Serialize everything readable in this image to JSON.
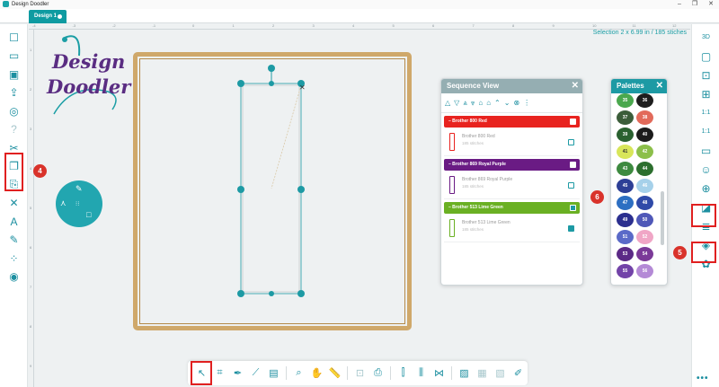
{
  "window": {
    "title": "Design Doodler",
    "controls": [
      "–",
      "❐",
      "✕"
    ]
  },
  "tabs": [
    {
      "label": "Design 1"
    }
  ],
  "selection_info": "Selection   2 x 6.99 in / 185 stiches",
  "ruler": {
    "top": [
      "-4",
      "-3",
      "-2",
      "-1",
      "0",
      "1",
      "2",
      "3",
      "4",
      "5",
      "6",
      "7",
      "8",
      "9",
      "10",
      "11",
      "12"
    ],
    "left": [
      "1",
      "2",
      "3",
      "4",
      "5",
      "6",
      "7",
      "8",
      "9"
    ]
  },
  "logo": {
    "line1": "Design",
    "line2": "Doodler"
  },
  "left_toolbar": [
    {
      "name": "new-design-icon",
      "glyph": "☐"
    },
    {
      "name": "open-folder-icon",
      "glyph": "▭"
    },
    {
      "name": "import-image-icon",
      "glyph": "▣"
    },
    {
      "name": "export-icon",
      "glyph": "⇪"
    },
    {
      "name": "stitch-settings-icon",
      "glyph": "◎"
    },
    {
      "name": "help-icon",
      "glyph": "?"
    },
    {
      "name": "cut-icon",
      "glyph": "✂"
    },
    {
      "name": "copy-icon",
      "glyph": "❐"
    },
    {
      "name": "paste-icon",
      "glyph": "⎘"
    },
    {
      "name": "delete-icon",
      "glyph": "✕"
    },
    {
      "name": "text-icon",
      "glyph": "A"
    },
    {
      "name": "draw-path-icon",
      "glyph": "✎"
    },
    {
      "name": "node-edit-icon",
      "glyph": "⁘"
    },
    {
      "name": "brush-tool-icon",
      "glyph": "◉"
    }
  ],
  "right_toolbar": [
    {
      "name": "3d-view-icon",
      "glyph": "3D"
    },
    {
      "name": "hoop-view-icon",
      "glyph": "▢"
    },
    {
      "name": "fit-screen-icon",
      "glyph": "⊡"
    },
    {
      "name": "zoom-selection-icon",
      "glyph": "⊞"
    },
    {
      "name": "actual-size-icon",
      "glyph": "1:1"
    },
    {
      "name": "screen-size-icon",
      "glyph": "1:1"
    },
    {
      "name": "monitor-icon",
      "glyph": "▭"
    },
    {
      "name": "assistant-icon",
      "glyph": "☺"
    },
    {
      "name": "add-layer-icon",
      "glyph": "⊕"
    },
    {
      "name": "color-sequence-icon",
      "glyph": "◪"
    },
    {
      "name": "layers-icon",
      "glyph": "≣"
    },
    {
      "name": "stack-icon",
      "glyph": "◈"
    },
    {
      "name": "palette-library-icon",
      "glyph": "✿"
    }
  ],
  "widget": {
    "top_icon": "✎",
    "left_icon": "⋏",
    "right_icon": "□",
    "center_icon": "⁝⁝"
  },
  "sequence_panel": {
    "title": "Sequence View",
    "close": "✕",
    "toolbar_icons": [
      "△",
      "▽",
      "⩓",
      "⩔",
      "⌂",
      "⌂",
      "⌃",
      "⌄",
      "⊗",
      "⋮"
    ],
    "groups": [
      {
        "label": "–  Brother 800 Red",
        "color": "#e8231f",
        "checked": false,
        "item": {
          "name": "Brother 800 Red",
          "stitches": "185 stitches",
          "checked": false
        }
      },
      {
        "label": "–  Brother 869 Royal Purple",
        "color": "#6a1b84",
        "checked": false,
        "item": {
          "name": "Brother 869 Royal Purple",
          "stitches": "185 stitches",
          "checked": false
        }
      },
      {
        "label": "–  Brother 513 Lime Green",
        "color": "#6ab023",
        "checked": true,
        "item": {
          "name": "Brother 513 Lime Green",
          "stitches": "185 stitches",
          "checked": true
        }
      }
    ]
  },
  "palette_panel": {
    "title": "Palettes",
    "close": "✕",
    "swatches": [
      {
        "num": "35",
        "color": "#4aa84e",
        "text": "#ffffff"
      },
      {
        "num": "36",
        "color": "#1e1e1e",
        "text": "#ffffff"
      },
      {
        "num": "37",
        "color": "#3b5d3a",
        "text": "#ffffff"
      },
      {
        "num": "38",
        "color": "#e26a5a",
        "text": "#ffffff"
      },
      {
        "num": "39",
        "color": "#2a6130",
        "text": "#ffffff"
      },
      {
        "num": "40",
        "color": "#1c1c1c",
        "text": "#ffffff"
      },
      {
        "num": "41",
        "color": "#d8e65a",
        "text": "#333333"
      },
      {
        "num": "42",
        "color": "#8cbf4a",
        "text": "#ffffff"
      },
      {
        "num": "43",
        "color": "#3d8a3f",
        "text": "#ffffff"
      },
      {
        "num": "44",
        "color": "#2c6f2e",
        "text": "#ffffff"
      },
      {
        "num": "45",
        "color": "#2d3f96",
        "text": "#ffffff"
      },
      {
        "num": "46",
        "color": "#a6d1ea",
        "text": "#ffffff"
      },
      {
        "num": "47",
        "color": "#2d6fc2",
        "text": "#ffffff"
      },
      {
        "num": "48",
        "color": "#2f4aa8",
        "text": "#ffffff"
      },
      {
        "num": "49",
        "color": "#2b2f8f",
        "text": "#ffffff"
      },
      {
        "num": "50",
        "color": "#4f58b8",
        "text": "#ffffff"
      },
      {
        "num": "51",
        "color": "#5a6ac8",
        "text": "#ffffff"
      },
      {
        "num": "52",
        "color": "#f0a6c6",
        "text": "#ffffff"
      },
      {
        "num": "53",
        "color": "#5b2a86",
        "text": "#ffffff"
      },
      {
        "num": "54",
        "color": "#7b3a98",
        "text": "#ffffff"
      },
      {
        "num": "55",
        "color": "#7243a8",
        "text": "#ffffff"
      },
      {
        "num": "56",
        "color": "#b48ad6",
        "text": "#ffffff"
      }
    ]
  },
  "bottom_toolbar": [
    {
      "name": "select-tool-icon",
      "glyph": "↖"
    },
    {
      "name": "transform-tool-icon",
      "glyph": "⌗"
    },
    {
      "name": "pen-tool-icon",
      "glyph": "✒"
    },
    {
      "name": "line-tool-icon",
      "glyph": "⟋"
    },
    {
      "name": "shape-tool-icon",
      "glyph": "▤"
    },
    {
      "name": "zoom-tool-icon",
      "glyph": "⌕"
    },
    {
      "name": "pan-tool-icon",
      "glyph": "✋"
    },
    {
      "name": "measure-tool-icon",
      "glyph": "📏"
    },
    {
      "name": "group-icon",
      "glyph": "⊡"
    },
    {
      "name": "print-icon",
      "glyph": "⎙"
    },
    {
      "name": "align-icon",
      "glyph": "⫿"
    },
    {
      "name": "distribute-icon",
      "glyph": "⫼"
    },
    {
      "name": "mirror-icon",
      "glyph": "⋈"
    },
    {
      "name": "image-icon",
      "glyph": "▨"
    },
    {
      "name": "trace-icon",
      "glyph": "▦"
    },
    {
      "name": "fill-icon",
      "glyph": "▧"
    },
    {
      "name": "edit-design-icon",
      "glyph": "✐"
    }
  ],
  "callouts": [
    "4",
    "5",
    "6"
  ],
  "more": "•••",
  "colors": {
    "accent": "#1d9aa4",
    "highlight": "#e02020",
    "hoop": "#cfa86a",
    "node": "#1d9aa4"
  }
}
